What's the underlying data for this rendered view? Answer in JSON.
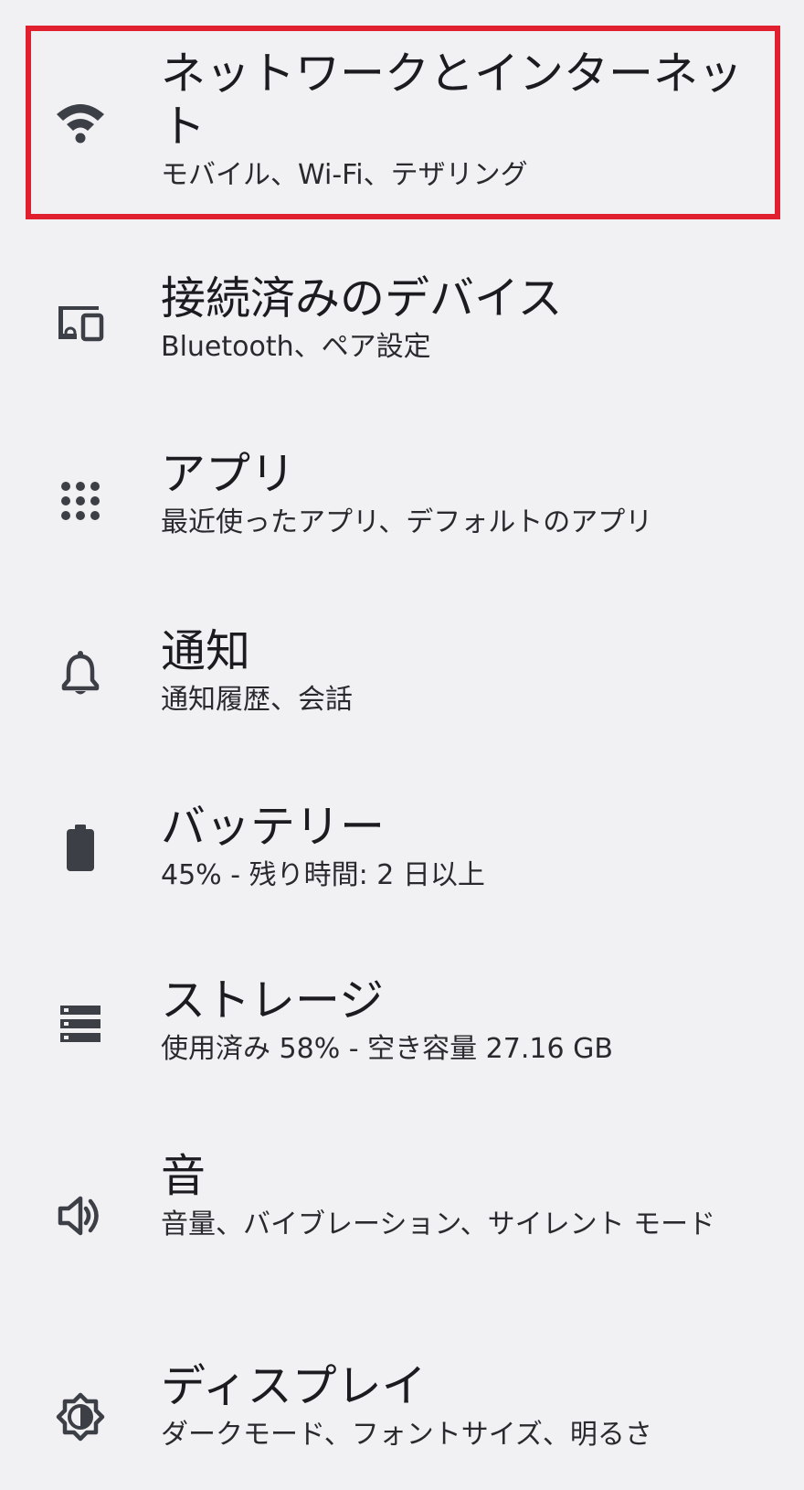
{
  "settings": {
    "items": [
      {
        "id": "network",
        "icon": "wifi-icon",
        "title": "ネットワークとインターネット",
        "subtitle": "モバイル、Wi-Fi、テザリング"
      },
      {
        "id": "devices",
        "icon": "connected-devices-icon",
        "title": "接続済みのデバイス",
        "subtitle": "Bluetooth、ペア設定"
      },
      {
        "id": "apps",
        "icon": "apps-grid-icon",
        "title": "アプリ",
        "subtitle": "最近使ったアプリ、デフォルトのアプリ"
      },
      {
        "id": "notifications",
        "icon": "bell-icon",
        "title": "通知",
        "subtitle": "通知履歴、会話"
      },
      {
        "id": "battery",
        "icon": "battery-icon",
        "title": "バッテリー",
        "subtitle": "45% - 残り時間: 2 日以上"
      },
      {
        "id": "storage",
        "icon": "storage-icon",
        "title": "ストレージ",
        "subtitle": "使用済み 58% - 空き容量 27.16 GB"
      },
      {
        "id": "sound",
        "icon": "speaker-icon",
        "title": "音",
        "subtitle": "音量、バイブレーション、サイレント モード"
      },
      {
        "id": "display",
        "icon": "brightness-icon",
        "title": "ディスプレイ",
        "subtitle": "ダークモード、フォントサイズ、明るさ"
      }
    ]
  },
  "colors": {
    "background": "#f1f1f4",
    "icon": "#3c4046",
    "highlight_border": "#e0202e"
  }
}
